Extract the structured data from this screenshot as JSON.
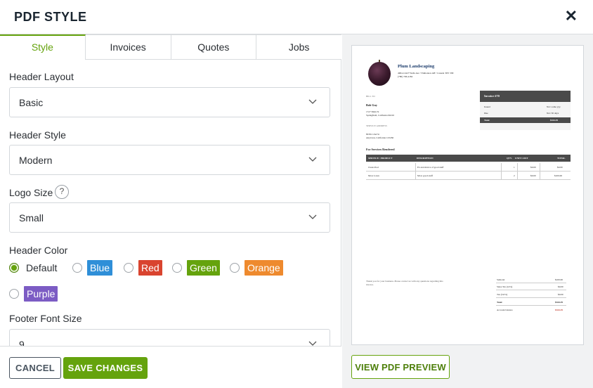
{
  "header": {
    "title": "PDF STYLE",
    "close_symbol": "✕"
  },
  "tabs": [
    {
      "label": "Style",
      "active": true
    },
    {
      "label": "Invoices",
      "active": false
    },
    {
      "label": "Quotes",
      "active": false
    },
    {
      "label": "Jobs",
      "active": false
    }
  ],
  "form": {
    "header_layout": {
      "label": "Header Layout",
      "value": "Basic"
    },
    "header_style": {
      "label": "Header Style",
      "value": "Modern"
    },
    "logo_size": {
      "label": "Logo Size",
      "value": "Small",
      "help": "?"
    },
    "header_color": {
      "label": "Header Color",
      "options": [
        {
          "label": "Default",
          "color": "",
          "checked": true
        },
        {
          "label": "Blue",
          "color": "#2f8fd8",
          "checked": false
        },
        {
          "label": "Red",
          "color": "#d9442f",
          "checked": false
        },
        {
          "label": "Green",
          "color": "#65a30d",
          "checked": false
        },
        {
          "label": "Orange",
          "color": "#ee8a2e",
          "checked": false
        },
        {
          "label": "Purple",
          "color": "#7c5cc4",
          "checked": false
        }
      ]
    },
    "footer_font_size": {
      "label": "Footer Font Size",
      "value": "9"
    }
  },
  "actions": {
    "cancel": "CANCEL",
    "save": "SAVE CHANGES",
    "view_preview": "VIEW PDF PREVIEW"
  },
  "preview": {
    "company": "Plum Landscaping",
    "company_address": "4904-12427 Wells Ave • Edmonton AB • Canada T6Y 3S8",
    "company_phone": "(780) 796-4184",
    "bill_to_label": "BILL TO",
    "client_name": "Bob Guy",
    "client_address_1": "1517 Main St",
    "client_address_2": "Springfield, California 90210",
    "service_label": "SERVICE ADDRESS",
    "service_address_1": "89 812 2nd St",
    "service_address_2": "Anytown, California 123456",
    "invoice_title": "Invoice #70",
    "issued_label": "Issued",
    "issued_value": "Nov some yyy",
    "due_label": "Due",
    "due_value": "Nov 30 days",
    "total_label": "Total",
    "total_value": "$344.29",
    "section_title": "For Services Rendered",
    "table_headers": [
      "SERVICE / PRODUCT",
      "DESCRIPTION",
      "QTY.",
      "UNIT COST",
      "TOTAL"
    ],
    "table_rows": [
      [
        "Clean Pool",
        "Ex and device of good stuff",
        "1",
        "$0.00",
        "$0.00"
      ],
      [
        "Mow Lawn",
        "Mow good stuff",
        "2",
        "$0.00",
        "$100.00"
      ]
    ],
    "footer_note": "Thank you for your business. Please contact us with any questions regarding this invoice.",
    "summary": [
      [
        "Subtotal",
        "$100.00"
      ],
      [
        "Sales Tax (14%)",
        "$0.00"
      ],
      [
        "Tax (5.0%)",
        "$0.00"
      ],
      [
        "Total",
        "$344.29"
      ],
      [
        "Account balance",
        "$344.29"
      ]
    ]
  },
  "colors": {
    "accent": "#65a30d",
    "border": "#d9dcdf",
    "text": "#2a2e33"
  }
}
